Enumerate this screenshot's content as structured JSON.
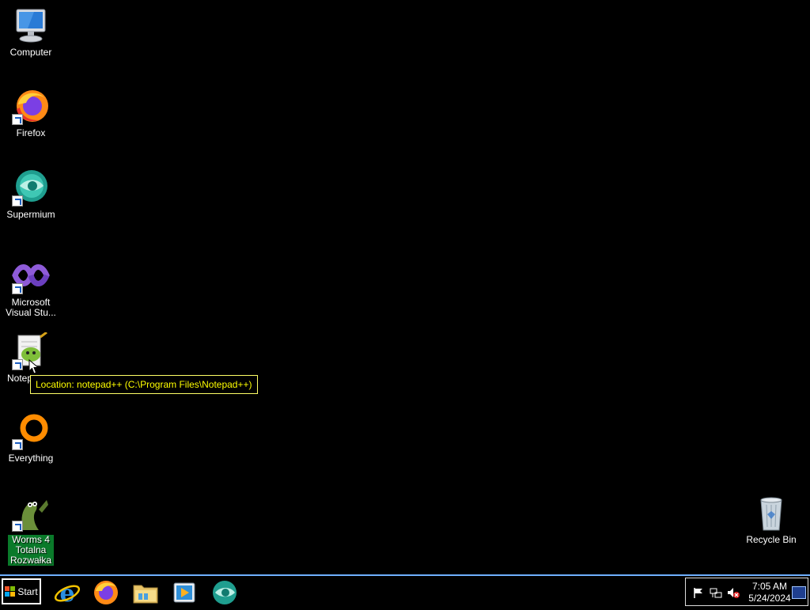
{
  "desktop": {
    "icons": [
      {
        "label": "Computer",
        "icon": "computer-icon"
      },
      {
        "label": "Firefox",
        "icon": "firefox-icon"
      },
      {
        "label": "Supermium",
        "icon": "supermium-icon"
      },
      {
        "label": "Microsoft Visual Stu...",
        "icon": "visual-studio-icon"
      },
      {
        "label": "Notep",
        "icon": "notepad-plus-plus-icon"
      },
      {
        "label": "Everything",
        "icon": "everything-icon"
      },
      {
        "label": "Worms 4 Totalna Rozwałka",
        "icon": "worms-icon"
      },
      {
        "label": "Recycle Bin",
        "icon": "recycle-bin-icon"
      }
    ],
    "tooltip": "Location: notepad++ (C:\\Program Files\\Notepad++)"
  },
  "taskbar": {
    "start_label": "Start",
    "pinned": [
      "internet-explorer-icon",
      "firefox-icon",
      "file-explorer-icon",
      "media-player-icon",
      "supermium-icon"
    ],
    "tray_icons": [
      "action-center-flag-icon",
      "network-icon",
      "volume-muted-icon"
    ],
    "clock": {
      "time": "7:05 AM",
      "date": "5/24/2024"
    }
  },
  "colors": {
    "taskbar_border": "#6fb0ff",
    "tooltip_text": "#ffff00",
    "selection": "#0a7a2a"
  }
}
